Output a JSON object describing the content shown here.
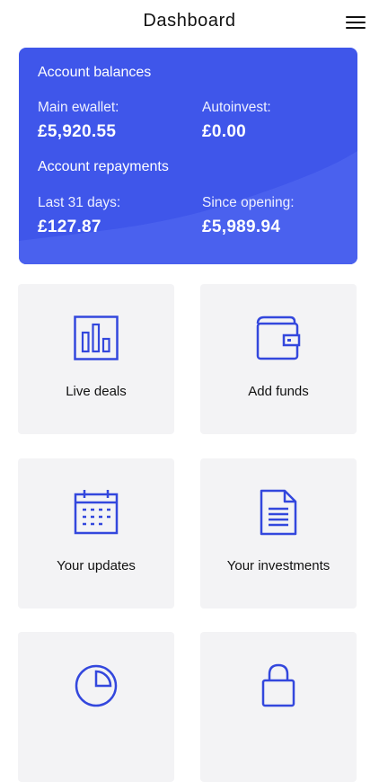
{
  "header": {
    "title": "Dashboard",
    "menu_icon": "hamburger-menu-icon"
  },
  "balances": {
    "heading": "Account balances",
    "main_ewallet_label": "Main ewallet:",
    "main_ewallet_value": "£5,920.55",
    "autoinvest_label": "Autoinvest:",
    "autoinvest_value": "£0.00"
  },
  "repayments": {
    "heading": "Account repayments",
    "last_31_days_label": "Last 31 days:",
    "last_31_days_value": "£127.87",
    "since_opening_label": "Since opening:",
    "since_opening_value": "£5,989.94"
  },
  "tiles": [
    {
      "label": "Live deals",
      "icon": "bar-chart-icon"
    },
    {
      "label": "Add funds",
      "icon": "wallet-icon"
    },
    {
      "label": "Your updates",
      "icon": "calendar-icon"
    },
    {
      "label": "Your investments",
      "icon": "document-icon"
    },
    {
      "label": "",
      "icon": "pie-chart-icon"
    },
    {
      "label": "",
      "icon": "lock-icon"
    }
  ],
  "colors": {
    "accent": "#3f56ea",
    "accent_light": "#4a61ee",
    "icon_stroke": "#3347dd",
    "tile_background": "#f3f3f5"
  }
}
